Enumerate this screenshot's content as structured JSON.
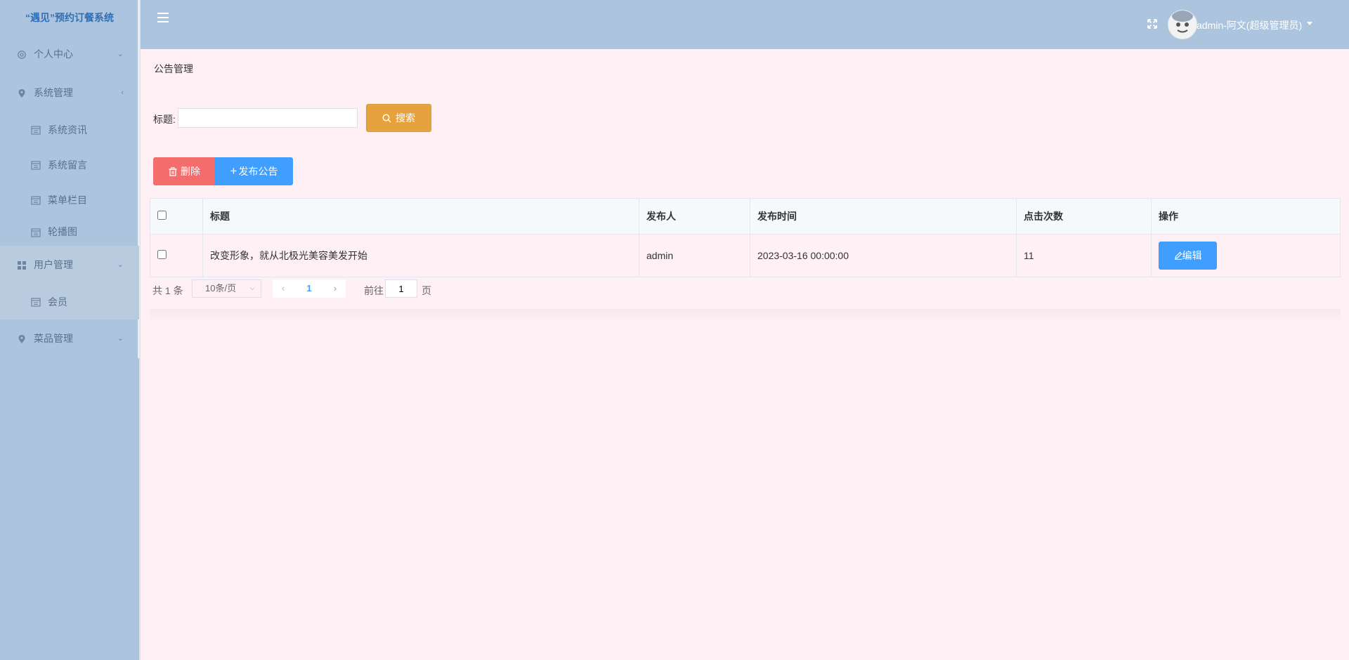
{
  "sidebar": {
    "brand": "“遇见”预约订餐系统",
    "menu": [
      {
        "label": "个人中心",
        "chevron": "⌄"
      },
      {
        "label": "系统管理",
        "chevron": "‹"
      },
      {
        "label": "用户管理",
        "chevron": "⌄"
      },
      {
        "label": "菜品管理",
        "chevron": "⌄"
      }
    ],
    "system_sub": [
      {
        "label": "系统资讯"
      },
      {
        "label": "系统留言"
      },
      {
        "label": "菜单栏目"
      },
      {
        "label": "轮播图"
      }
    ],
    "user_sub": [
      {
        "label": "会员"
      }
    ]
  },
  "header": {
    "user_label": "admin-阿文(超级管理员)"
  },
  "page": {
    "title": "公告管理",
    "search_label": "标题:",
    "search_placeholder": "",
    "search_button": "搜索",
    "delete_button": "删除",
    "add_button": "发布公告"
  },
  "table": {
    "columns": [
      "标题",
      "发布人",
      "发布时间",
      "点击次数",
      "操作"
    ],
    "rows": [
      {
        "title": "改变形象，就从北极光美容美发开始",
        "publisher": "admin",
        "time": "2023-03-16 00:00:00",
        "clicks": "11",
        "edit": "编辑"
      }
    ]
  },
  "pagination": {
    "total": "共 1 条",
    "page_size": "10条/页",
    "current_page": "1",
    "goto_label": "前往",
    "goto_value": "1",
    "goto_suffix": "页"
  },
  "colors": {
    "sidebar_bg": "#adc4de",
    "content_bg": "#fff0f5",
    "primary": "#409eff",
    "danger": "#f56c6c",
    "warning": "#e6a23c"
  }
}
